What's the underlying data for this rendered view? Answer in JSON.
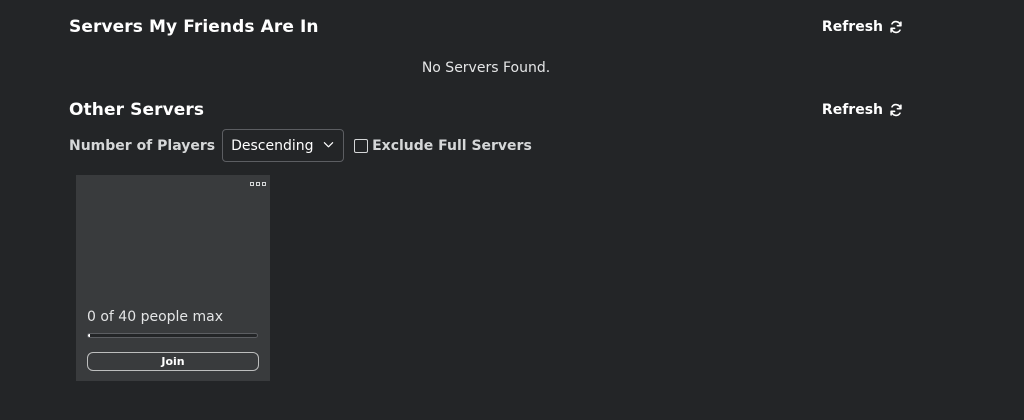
{
  "friends_section": {
    "title": "Servers My Friends Are In",
    "refresh_label": "Refresh",
    "refresh_icon": "refresh-icon",
    "empty_message": "No Servers Found."
  },
  "other_section": {
    "title": "Other Servers",
    "refresh_label": "Refresh",
    "refresh_icon": "refresh-icon",
    "filters": {
      "sort_label": "Number of Players",
      "sort_selected": "Descending",
      "exclude_full_label": "Exclude Full Servers",
      "exclude_full_checked": false
    },
    "servers": [
      {
        "player_count_text": "0 of 40 people max",
        "players": 0,
        "max_players": 40,
        "capacity_fraction": 0,
        "join_label": "Join",
        "menu_icon": "more-options-icon"
      }
    ]
  },
  "colors": {
    "background": "#232527",
    "card": "#393b3d",
    "text": "#ffffff",
    "muted_text": "#d5d7d8",
    "border": "#5c5e62"
  }
}
